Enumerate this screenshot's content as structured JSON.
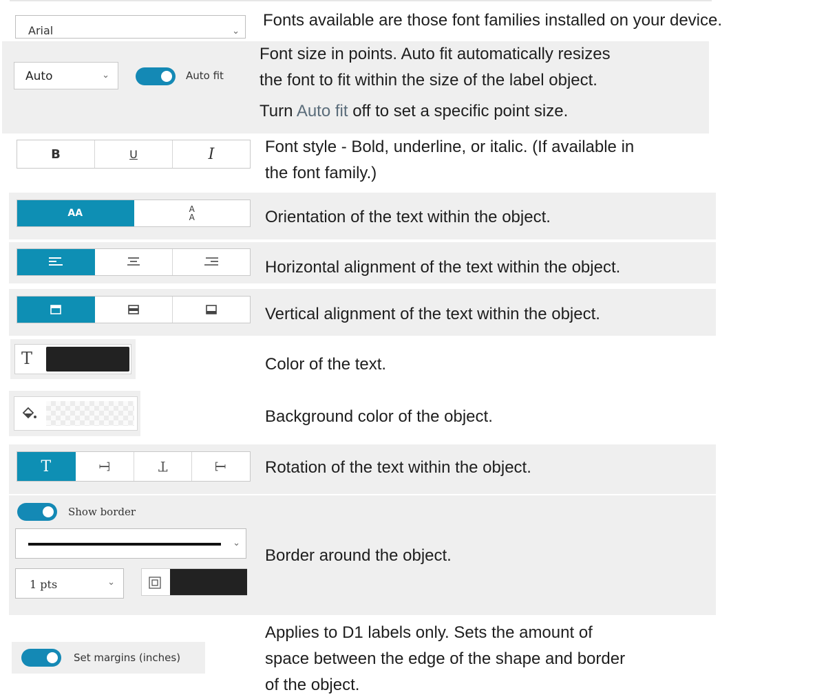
{
  "font_family": {
    "selected": "Arial",
    "description": "Fonts available are those font families installed on your device."
  },
  "font_size": {
    "selected": "Auto",
    "auto_fit_label": "Auto fit",
    "auto_fit_on": true,
    "description_line1": "Font size in points. Auto fit automatically resizes",
    "description_line2": "the font to fit within the size of the label object.",
    "description_line3_pre": "Turn ",
    "description_line3_link": "Auto fit",
    "description_line3_post": " off to set a specific point size."
  },
  "font_style": {
    "buttons": [
      "B",
      "U",
      "I"
    ],
    "description_line1": "Font style - Bold, underline, or italic. (If available in",
    "description_line2": "the font family.)"
  },
  "orientation": {
    "buttons": [
      "AA",
      "A A"
    ],
    "active_index": 0,
    "description": "Orientation of the text within the object."
  },
  "horizontal_alignment": {
    "active_index": 0,
    "description": "Horizontal alignment of the text within the object."
  },
  "vertical_alignment": {
    "active_index": 0,
    "description": "Vertical alignment of the text within the object."
  },
  "text_color": {
    "icon_glyph": "T",
    "swatch_color": "#222222",
    "description": "Color of the text."
  },
  "background_color": {
    "description": "Background color of the object."
  },
  "rotation": {
    "active_index": 0,
    "description": "Rotation of the text within the object."
  },
  "border": {
    "show_border_label": "Show border",
    "show_border_on": true,
    "width_selected": "1 pts",
    "swatch_color": "#222222",
    "description": "Border around the object."
  },
  "margins": {
    "label": "Set margins (inches)",
    "on": true,
    "description_line1": "Applies to D1 labels only. Sets the amount of",
    "description_line2": "space between the edge of the shape and border",
    "description_line3": "of the object."
  },
  "colors": {
    "accent": "#0e8fb4",
    "band": "#efefef"
  }
}
